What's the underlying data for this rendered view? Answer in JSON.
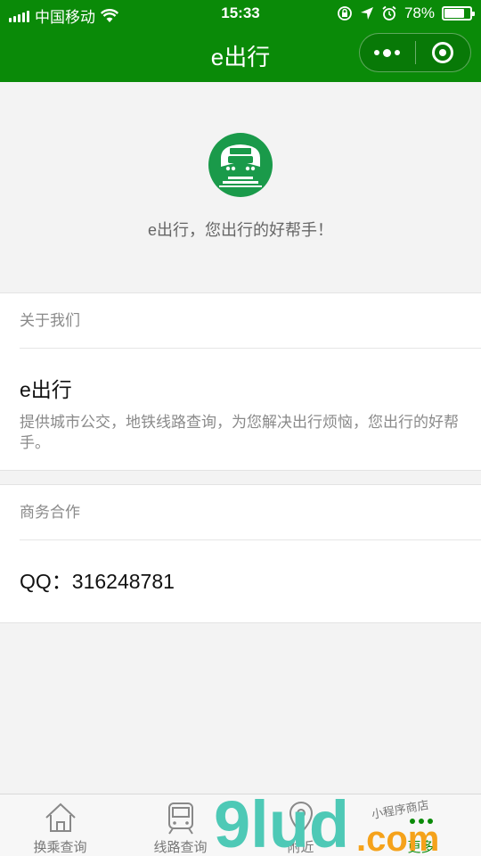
{
  "status": {
    "carrier": "中国移动",
    "time": "15:33",
    "battery_percent": "78%",
    "battery_level": 0.78
  },
  "nav": {
    "title": "e出行",
    "more_icon": "more-dots-icon",
    "close_icon": "target-circle-icon"
  },
  "hero": {
    "logo_icon": "train-logo-icon",
    "slogan": "e出行，您出行的好帮手！"
  },
  "about": {
    "header": "关于我们",
    "title": "e出行",
    "description": "提供城市公交，地铁线路查询，为您解决出行烦恼，您出行的好帮手。"
  },
  "business": {
    "header": "商务合作",
    "qq": "QQ：316248781"
  },
  "tabbar": {
    "items": [
      {
        "label": "换乘查询",
        "icon": "home-icon"
      },
      {
        "label": "线路查询",
        "icon": "train-icon"
      },
      {
        "label": "附近",
        "icon": "location-pin-icon"
      },
      {
        "label": "更多",
        "icon": "more-icon"
      }
    ],
    "active_index": 3
  },
  "watermark": {
    "text": "9lud",
    "domain": ".com",
    "caption": "小程序商店"
  },
  "colors": {
    "brand_green": "#0a8a08",
    "logo_green": "#1a9a4a",
    "watermark_teal": "#4ec9b6",
    "watermark_orange": "#f5a21b"
  }
}
